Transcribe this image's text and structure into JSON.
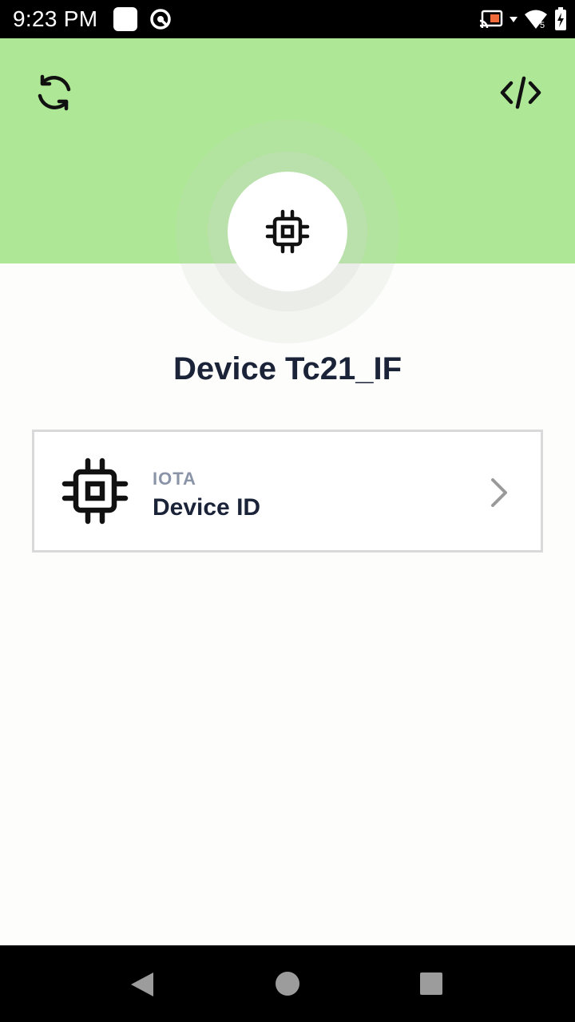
{
  "status_bar": {
    "time": "9:23 PM",
    "signal_badge": "5"
  },
  "header": {
    "left_icon": "refresh-icon",
    "right_icon": "code-icon",
    "avatar_icon": "chip-icon",
    "color": "#aee796"
  },
  "device": {
    "title": "Device Tc21_IF"
  },
  "card": {
    "icon": "chip-icon",
    "kicker": "IOTA",
    "title": "Device ID",
    "chevron": "chevron-right-icon"
  },
  "nav_bar": {
    "back": "back-icon",
    "home": "home-icon",
    "recent": "recent-apps-icon"
  }
}
